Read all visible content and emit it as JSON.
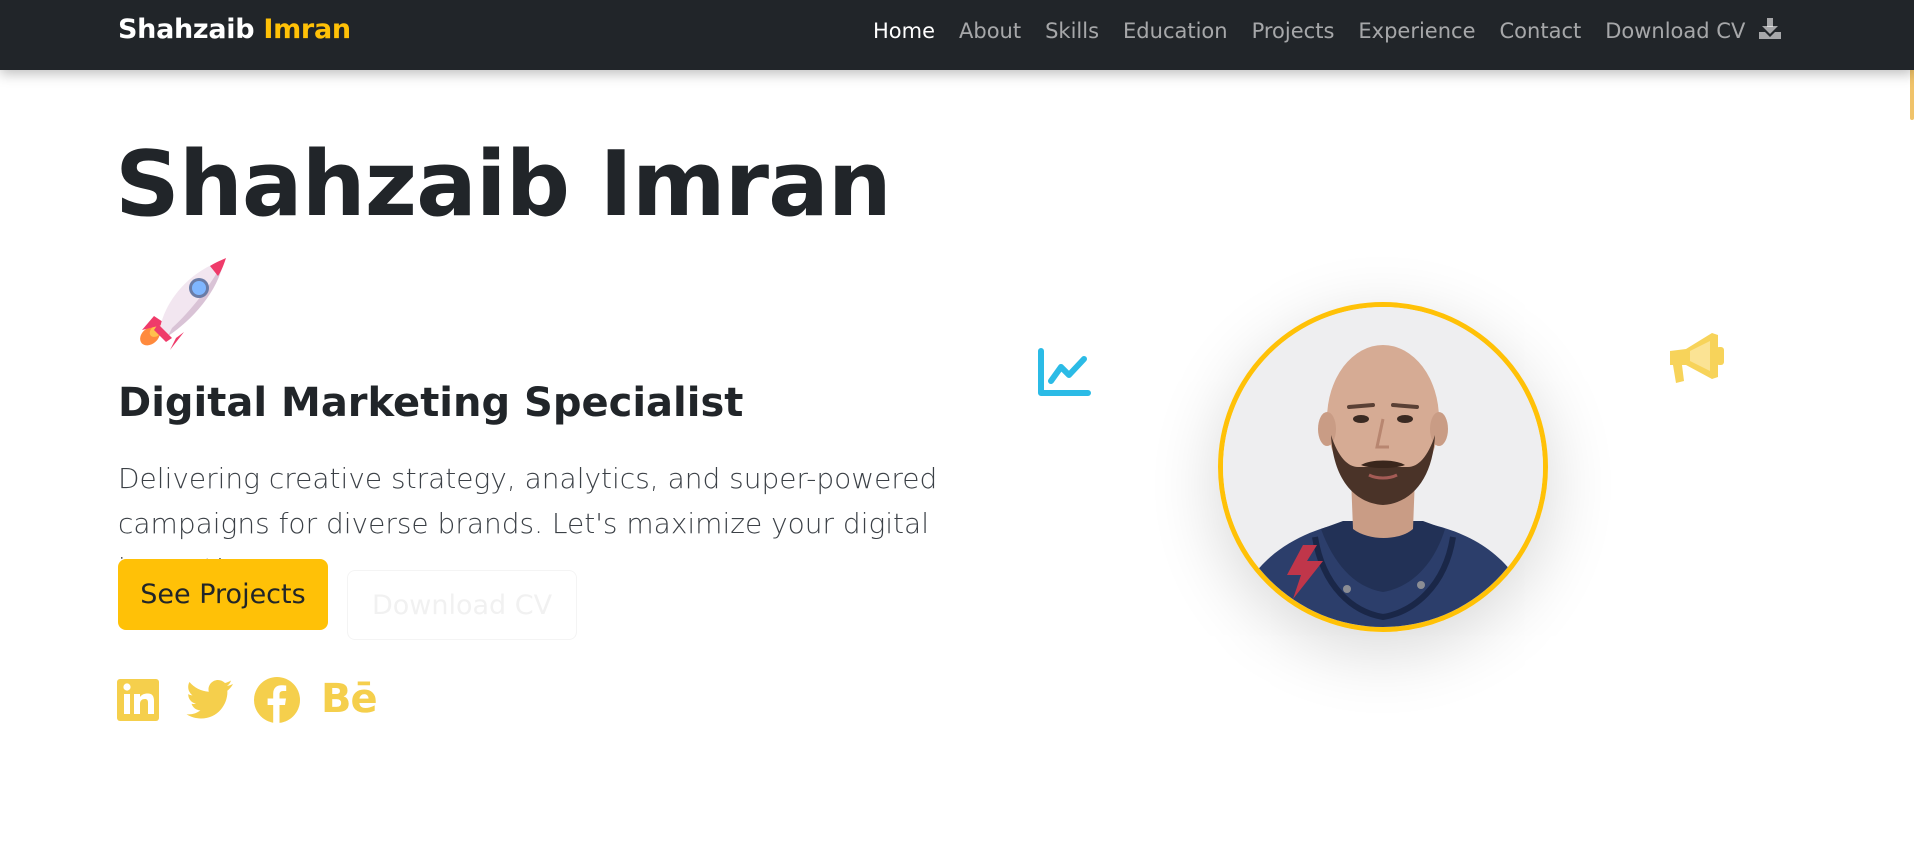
{
  "navbar": {
    "brand_first": "Shahzaib",
    "brand_last": "Imran",
    "links": [
      {
        "label": "Home",
        "active": true
      },
      {
        "label": "About"
      },
      {
        "label": "Skills"
      },
      {
        "label": "Education"
      },
      {
        "label": "Projects"
      },
      {
        "label": "Experience"
      },
      {
        "label": "Contact"
      },
      {
        "label": "Download CV",
        "icon": "download-icon"
      }
    ]
  },
  "hero": {
    "title": "Shahzaib Imran",
    "emoji_icon": "rocket-icon",
    "subtitle": "Digital Marketing Specialist",
    "lead": "Delivering creative strategy, analytics, and super-powered campaigns for diverse brands. Let's maximize your digital impact!",
    "primary_button": "See Projects",
    "secondary_button": "Download CV",
    "socials": [
      {
        "name": "linkedin-icon"
      },
      {
        "name": "twitter-icon"
      },
      {
        "name": "facebook-icon"
      },
      {
        "name": "behance-icon",
        "text": "Bē"
      }
    ]
  },
  "profile": {
    "photo_icon": "profile-photo",
    "badge_icon": "lightning-icon",
    "floating_icons": [
      "chart-line-icon",
      "megaphone-icon"
    ]
  },
  "colors": {
    "accent": "#ffc107",
    "navbar_bg": "#212529",
    "chart_icon": "#2bbbe6",
    "badge": "#c0364a"
  }
}
